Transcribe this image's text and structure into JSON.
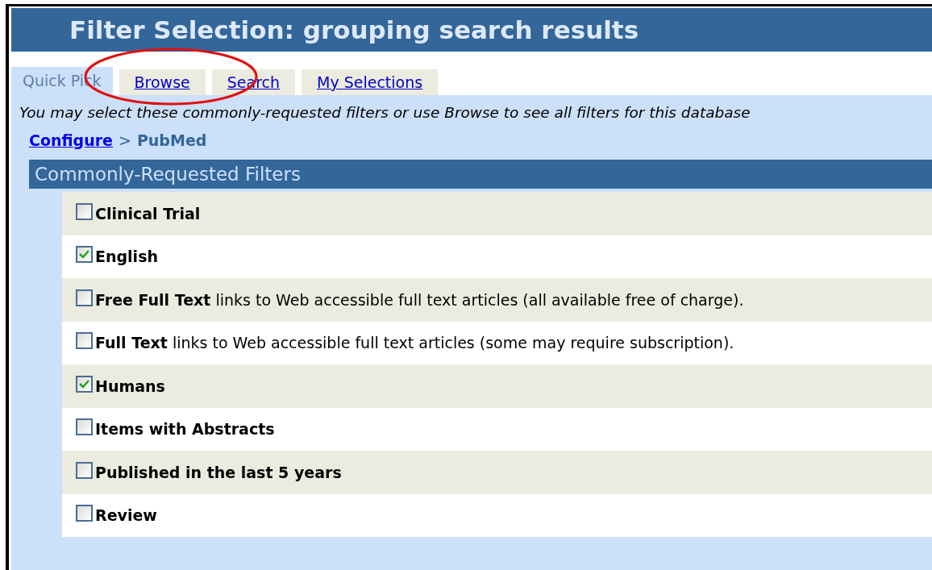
{
  "window": {
    "title": "Filter Selection: grouping search results"
  },
  "tabs": [
    {
      "label": "Quick Pick",
      "selected": true
    },
    {
      "label": "Browse",
      "selected": false
    },
    {
      "label": "Search",
      "selected": false
    },
    {
      "label": "My Selections",
      "selected": false
    }
  ],
  "instructions": "You may select these commonly-requested filters or use Browse to see all filters for this database",
  "breadcrumb": {
    "separator": ">",
    "items": [
      {
        "label": "Configure",
        "link": true
      },
      {
        "label": "PubMed",
        "link": false
      }
    ]
  },
  "filters": {
    "heading": "Commonly-Requested Filters",
    "items": [
      {
        "label": "Clinical Trial",
        "checked": false
      },
      {
        "label": "English",
        "checked": true
      },
      {
        "label": "Free Full Text",
        "description": "links to Web accessible full text articles (all available free of charge).",
        "checked": false
      },
      {
        "label": "Full Text",
        "description": "links to Web accessible full text articles (some may require subscription).",
        "checked": false
      },
      {
        "label": "Humans",
        "checked": true
      },
      {
        "label": "Items with Abstracts",
        "checked": false
      },
      {
        "label": "Published in the last 5 years",
        "checked": false
      },
      {
        "label": "Review",
        "checked": false
      }
    ]
  }
}
